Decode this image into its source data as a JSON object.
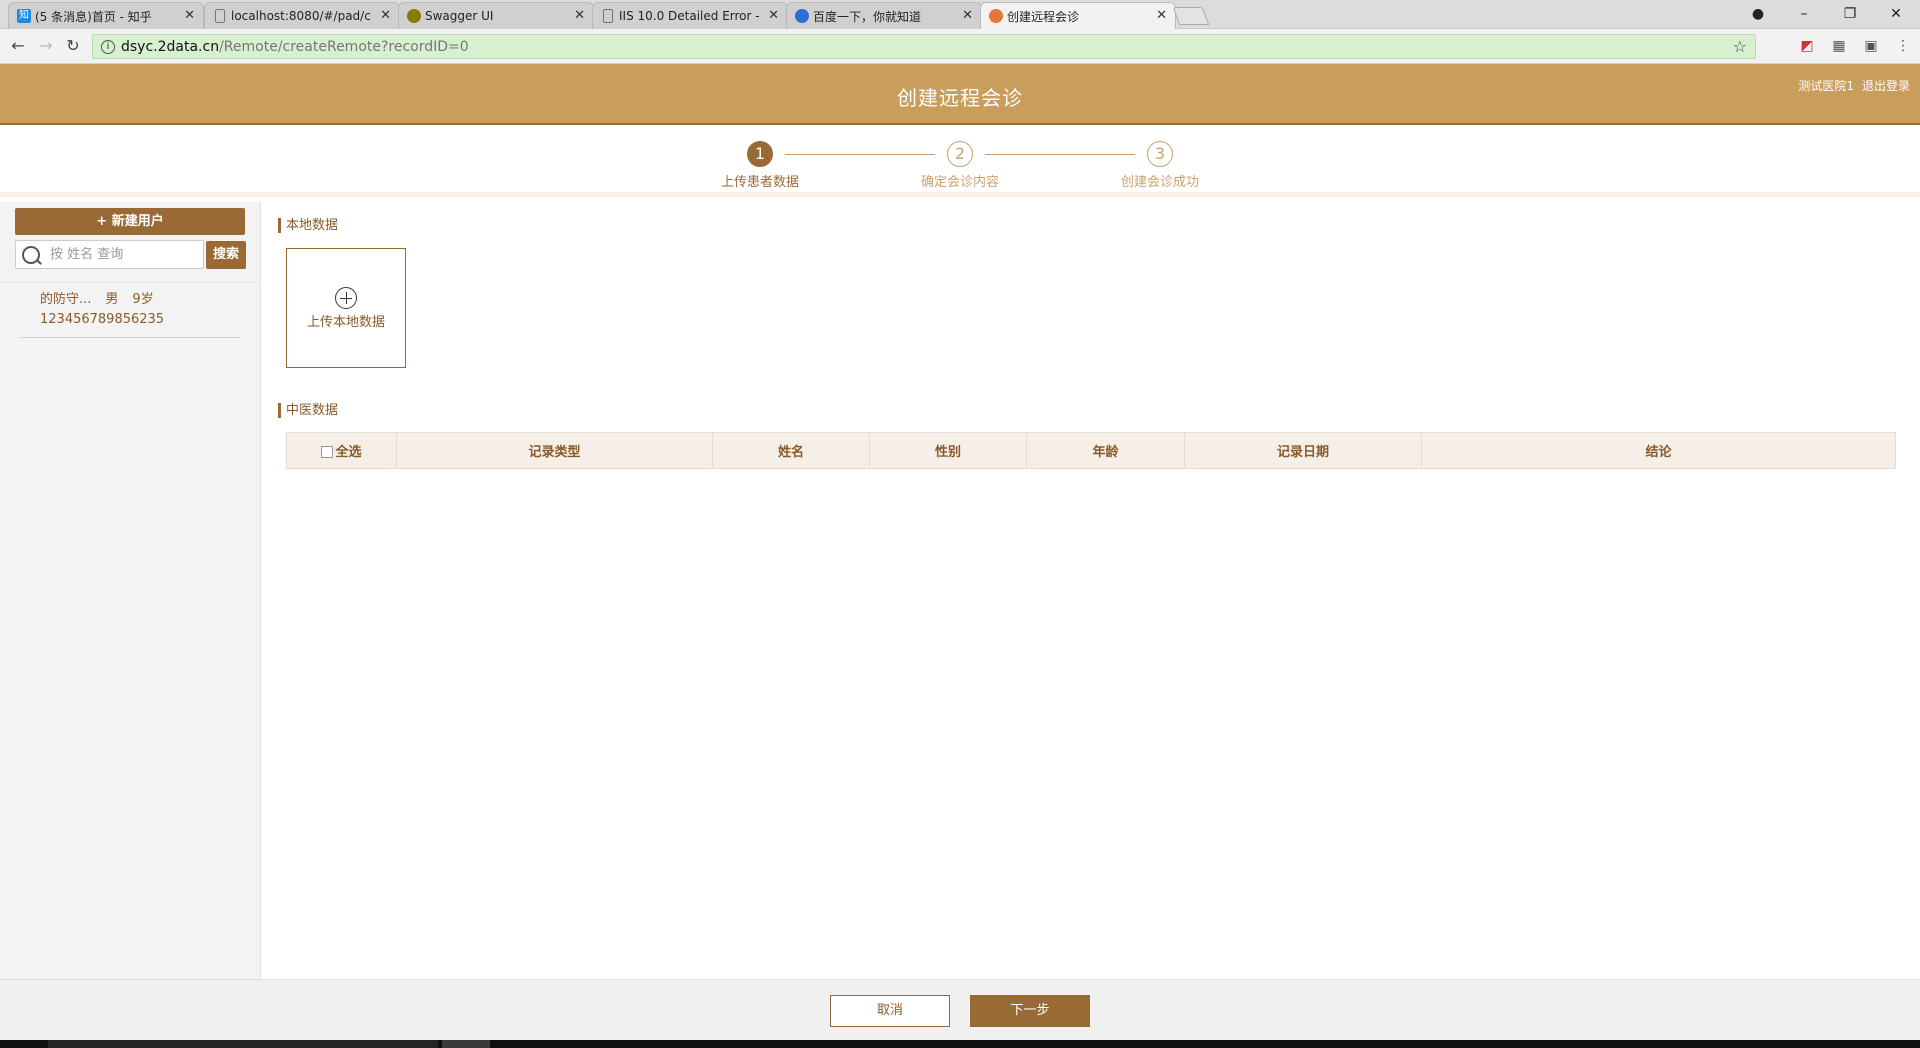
{
  "browser": {
    "tabs": [
      {
        "title": "(5 条消息)首页 - 知乎",
        "icon": "知",
        "color": "#1e88e5"
      },
      {
        "title": "localhost:8080/#/pad/c",
        "icon": "page-icon",
        "color": ""
      },
      {
        "title": "Swagger UI",
        "icon": "swagger-icon",
        "color": "#8a7a00"
      },
      {
        "title": "IIS 10.0 Detailed Error -",
        "icon": "page-icon",
        "color": ""
      },
      {
        "title": "百度一下，你就知道",
        "icon": "baidu-icon",
        "color": "#2d6fd8"
      },
      {
        "title": "创建远程会诊",
        "icon": "chrome-g-icon",
        "color": "#e8763a"
      }
    ],
    "url_host": "dsyc.2data.cn",
    "url_path": "/Remote/createRemote?recordID=0"
  },
  "header": {
    "title": "创建远程会诊",
    "hospital": "测试医院1",
    "logout": "退出登录"
  },
  "steps": [
    {
      "number": "1",
      "label": "上传患者数据",
      "done": true
    },
    {
      "number": "2",
      "label": "确定会诊内容",
      "done": false
    },
    {
      "number": "3",
      "label": "创建会诊成功",
      "done": false
    }
  ],
  "sidebar": {
    "new_user_label": "+ 新建用户",
    "search_placeholder": "按 姓名 查询",
    "search_label": "搜索",
    "patients": [
      {
        "name": "的防守...",
        "gender": "男",
        "age": "9岁",
        "id": "123456789856235"
      }
    ]
  },
  "main": {
    "local_section_title": "本地数据",
    "upload_label": "上传本地数据",
    "tcm_section_title": "中医数据",
    "table_headers": {
      "select_all": "全选",
      "record_type": "记录类型",
      "name": "姓名",
      "gender": "性别",
      "age": "年龄",
      "record_date": "记录日期",
      "conclusion": "结论"
    }
  },
  "footer": {
    "cancel_label": "取消",
    "next_label": "下一步"
  },
  "colors": {
    "brand": "#c99d5c",
    "brand_dark": "#9a6a36"
  }
}
